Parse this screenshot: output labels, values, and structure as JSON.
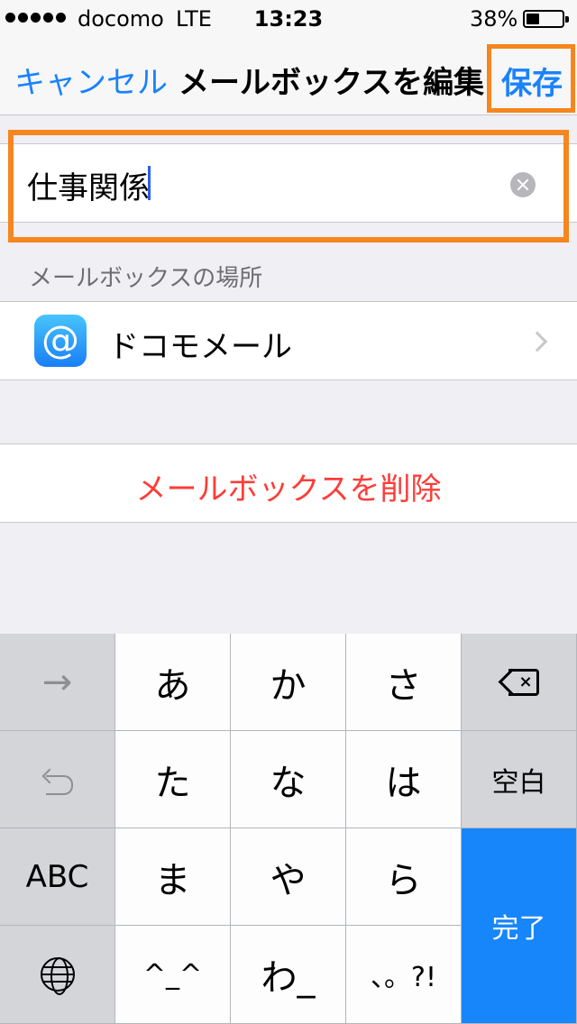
{
  "status_bar": {
    "carrier": "docomo",
    "network": "LTE",
    "time": "13:23",
    "battery_percent": "38%"
  },
  "nav": {
    "cancel_label": "キャンセル",
    "title": "メールボックスを編集",
    "save_label": "保存"
  },
  "mailbox_name": {
    "value": "仕事関係"
  },
  "location": {
    "section_title": "メールボックスの場所",
    "account_label": "ドコモメール",
    "icon_glyph": "@"
  },
  "delete_label": "メールボックスを削除",
  "colors": {
    "accent": "#1a82fb",
    "destructive": "#fc3d39",
    "highlight": "#f6861e"
  },
  "keyboard": {
    "keys": {
      "a": "あ",
      "ka": "か",
      "sa": "さ",
      "ta": "た",
      "na": "な",
      "ha": "は",
      "abc": "ABC",
      "ma": "ま",
      "ya": "や",
      "ra": "ら",
      "emoticon": "^_^",
      "wa": "わ_",
      "punct": "、。?!",
      "space": "空白",
      "done": "完了"
    },
    "icons": {
      "next": "right-arrow-icon",
      "undo": "undo-icon",
      "backspace": "backspace-icon",
      "globe": "globe-icon"
    }
  }
}
